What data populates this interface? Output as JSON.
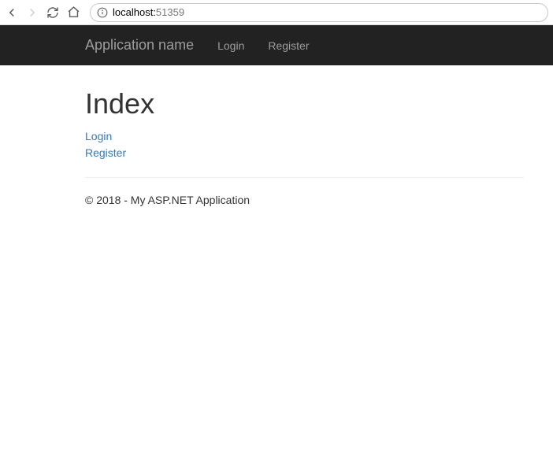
{
  "browser": {
    "url_host": "localhost:",
    "url_port": "51359"
  },
  "navbar": {
    "brand": "Application name",
    "links": {
      "login": "Login",
      "register": "Register"
    }
  },
  "page": {
    "title": "Index",
    "links": {
      "login": "Login",
      "register": "Register"
    }
  },
  "footer": {
    "text": "© 2018 - My ASP.NET Application"
  }
}
